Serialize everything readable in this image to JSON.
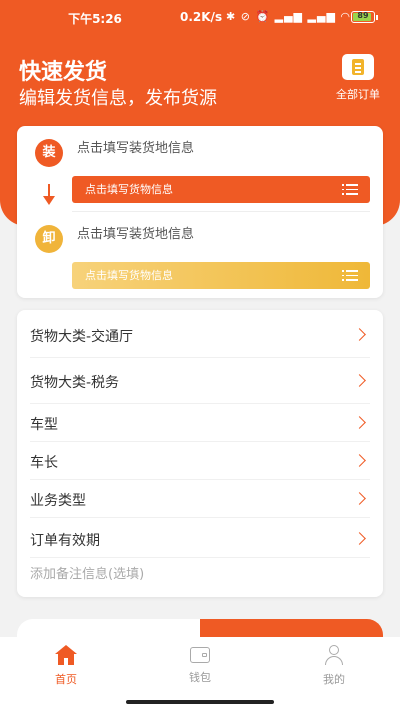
{
  "status_bar": {
    "time": "下午5:26",
    "network_speed": "0.2K/s",
    "icons": [
      "bluetooth-icon",
      "mute-icon",
      "alarm-icon",
      "signal-icon",
      "signal-icon",
      "wifi-icon"
    ],
    "battery": "89"
  },
  "header": {
    "title": "快速发货",
    "subtitle": "编辑发货信息，发布货源",
    "orders_label": "全部订单"
  },
  "route": {
    "load_badge": "装",
    "unload_badge": "卸",
    "load_address_placeholder": "点击填写装货地信息",
    "load_cargo_placeholder": "点击填写货物信息",
    "unload_address_placeholder": "点击填写装货地信息",
    "unload_cargo_placeholder": "点击填写货物信息"
  },
  "form": {
    "rows": [
      {
        "label": "货物大类-交通厅"
      },
      {
        "label": "货物大类-税务"
      },
      {
        "label": "车型"
      },
      {
        "label": "车长"
      },
      {
        "label": "业务类型"
      },
      {
        "label": "订单有效期"
      }
    ],
    "remark_placeholder": "添加备注信息(选填)"
  },
  "tabbar": {
    "items": [
      {
        "label": "首页",
        "icon": "home-icon",
        "active": true
      },
      {
        "label": "钱包",
        "icon": "wallet-icon",
        "active": false
      },
      {
        "label": "我的",
        "icon": "person-icon",
        "active": false
      }
    ]
  },
  "colors": {
    "brand": "#ef5a24",
    "unload": "#f0b43a",
    "muted_text": "#aaaaaa"
  }
}
